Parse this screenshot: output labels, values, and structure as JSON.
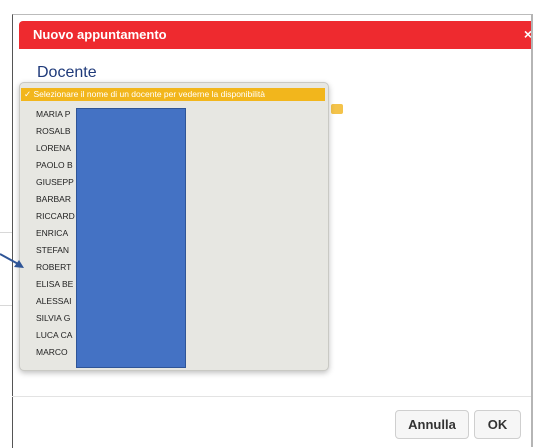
{
  "dialog": {
    "title": "Nuovo appuntamento",
    "close": "×",
    "section_label": "Docente"
  },
  "teacher_select": {
    "selected": "✓ Selezionare il nome di un docente per vederne la disponibilità",
    "options": [
      "MARIA P",
      "ROSALB",
      "LORENA",
      "PAOLO B",
      "GIUSEPP",
      "BARBAR",
      "RICCARD",
      "ENRICA",
      "STEFAN",
      "ROBERT",
      "ELISA BE",
      "ALESSAI",
      "SILVIA G",
      "LUCA CA",
      "MARCO"
    ]
  },
  "footer": {
    "cancel_label": "Annulla",
    "ok_label": "OK"
  },
  "colors": {
    "header": "#ee2a2f",
    "selected_option": "#f2b61c",
    "redaction": "#4472c4"
  }
}
